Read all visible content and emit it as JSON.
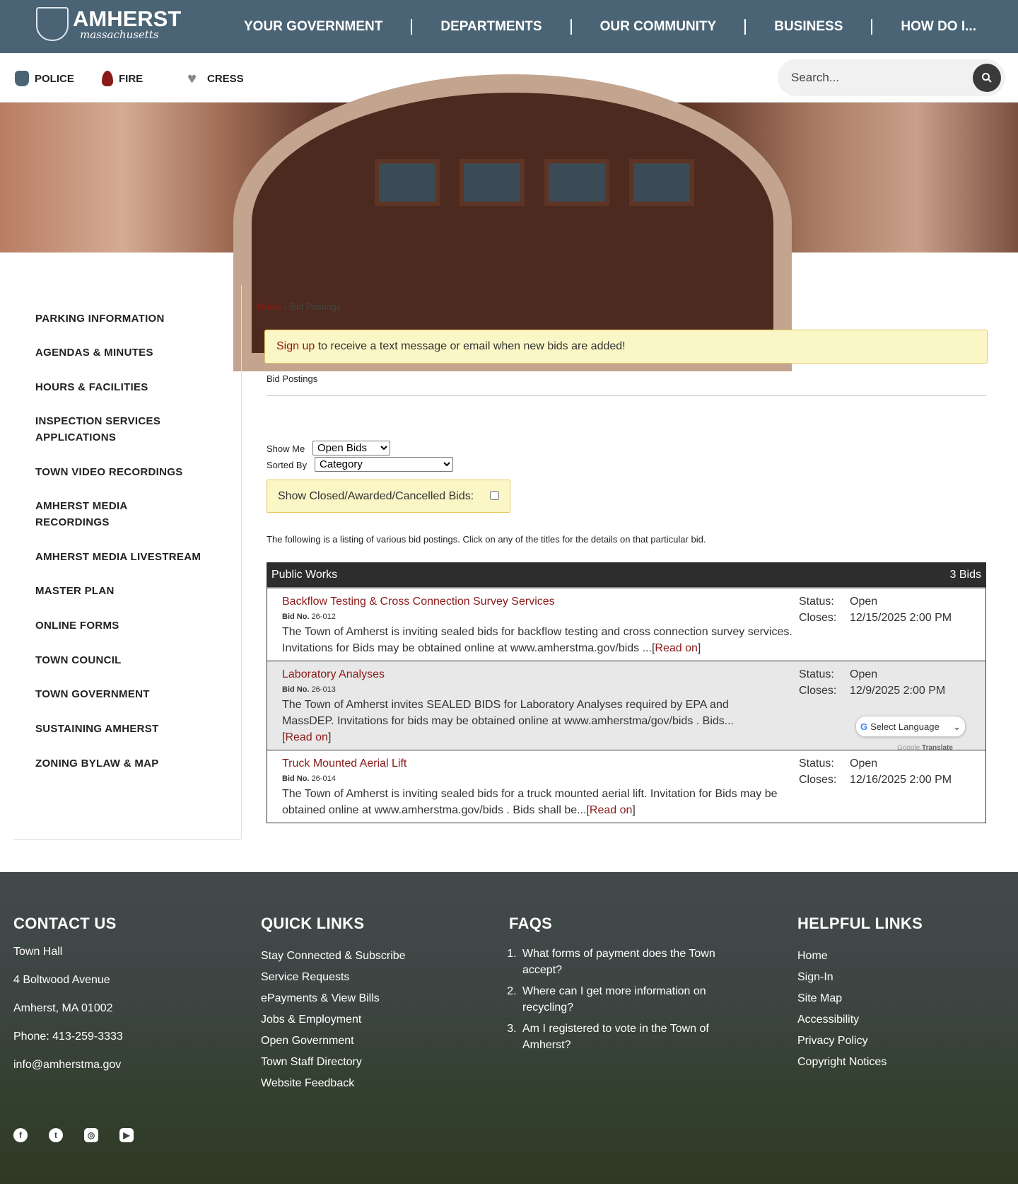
{
  "header": {
    "logo_main": "AMHERST",
    "logo_sub": "massachusetts",
    "nav": [
      "YOUR GOVERNMENT",
      "DEPARTMENTS",
      "OUR COMMUNITY",
      "BUSINESS",
      "HOW DO I..."
    ]
  },
  "quick_links": [
    {
      "label": "POLICE",
      "icon": "badge-icon"
    },
    {
      "label": "FIRE",
      "icon": "flame-icon"
    },
    {
      "label": "CRESS",
      "icon": "heart-icon"
    }
  ],
  "search": {
    "placeholder": "Search..."
  },
  "sidebar": [
    "PARKING INFORMATION",
    "AGENDAS & MINUTES",
    "HOURS & FACILITIES",
    "INSPECTION SERVICES APPLICATIONS",
    "TOWN VIDEO RECORDINGS",
    "AMHERST MEDIA RECORDINGS",
    "AMHERST MEDIA LIVESTREAM",
    "MASTER PLAN",
    "ONLINE FORMS",
    "TOWN COUNCIL",
    "TOWN GOVERNMENT",
    "SUSTAINING AMHERST",
    "ZONING BYLAW & MAP"
  ],
  "breadcrumb": {
    "home": "Home",
    "sep": "›",
    "current": "Bid Postings"
  },
  "alert": {
    "link": "Sign up",
    "text": " to receive a text message or email when new bids are added!"
  },
  "section_title": "Bid Postings",
  "filters": {
    "show_me_label": "Show Me",
    "show_me_value": "Open Bids",
    "sorted_by_label": "Sorted By",
    "sorted_by_value": "Category",
    "closed_label": "Show Closed/Awarded/Cancelled Bids:"
  },
  "intro": "The following is a listing of various bid postings. Click on any of the titles for the details on that particular bid.",
  "category": {
    "name": "Public Works",
    "count": "3 Bids"
  },
  "bid_no_label": "Bid No.",
  "status_label": "Status:",
  "closes_label": "Closes:",
  "read_on": "Read on",
  "bids": [
    {
      "title": "Backflow Testing & Cross Connection Survey Services",
      "number": "26-012",
      "desc": "The Town of Amherst is inviting sealed bids for backflow testing and cross connection survey services. Invitations for Bids may be obtained online at www.amherstma.gov/bids ...",
      "status": "Open",
      "closes": "12/15/2025 2:00 PM"
    },
    {
      "title": "Laboratory Analyses",
      "number": "26-013",
      "desc": "The Town of Amherst invites SEALED BIDS for Laboratory Analyses required by EPA and MassDEP. Invitations for bids may be obtained online at www.amherstma/gov/bids . Bids...",
      "status": "Open",
      "closes": "12/9/2025 2:00 PM"
    },
    {
      "title": "Truck Mounted Aerial Lift",
      "number": "26-014",
      "desc": "The Town of Amherst is inviting sealed bids for a truck mounted aerial lift. Invitation for Bids may be obtained online at www.amherstma.gov/bids . Bids shall be...",
      "status": "Open",
      "closes": "12/16/2025 2:00 PM"
    }
  ],
  "translate": {
    "select": "Select Language",
    "powered": "Google",
    "brand": "Translate"
  },
  "footer": {
    "contact": {
      "title": "CONTACT US",
      "lines": [
        "Town Hall",
        "4 Boltwood Avenue",
        "Amherst, MA 01002",
        "Phone: 413-259-3333",
        "info@amherstma.gov"
      ]
    },
    "quick": {
      "title": "QUICK LINKS",
      "links": [
        "Stay Connected & Subscribe",
        "Service Requests",
        "ePayments & View Bills",
        "Jobs & Employment",
        "Open Government",
        "Town Staff Directory",
        "Website Feedback"
      ]
    },
    "faqs": {
      "title": "FAQS",
      "items": [
        "What forms of payment does the Town accept?",
        "Where can I get more information on recycling?",
        "Am I registered to vote in the Town of Amherst?"
      ]
    },
    "helpful": {
      "title": "HELPFUL LINKS",
      "links": [
        "Home",
        "Sign-In",
        "Site Map",
        "Accessibility",
        "Privacy Policy",
        "Copyright Notices"
      ]
    }
  },
  "colors": {
    "header": "#4a6475",
    "link": "#8b1a1a",
    "alert_bg": "#fbf6c6"
  }
}
